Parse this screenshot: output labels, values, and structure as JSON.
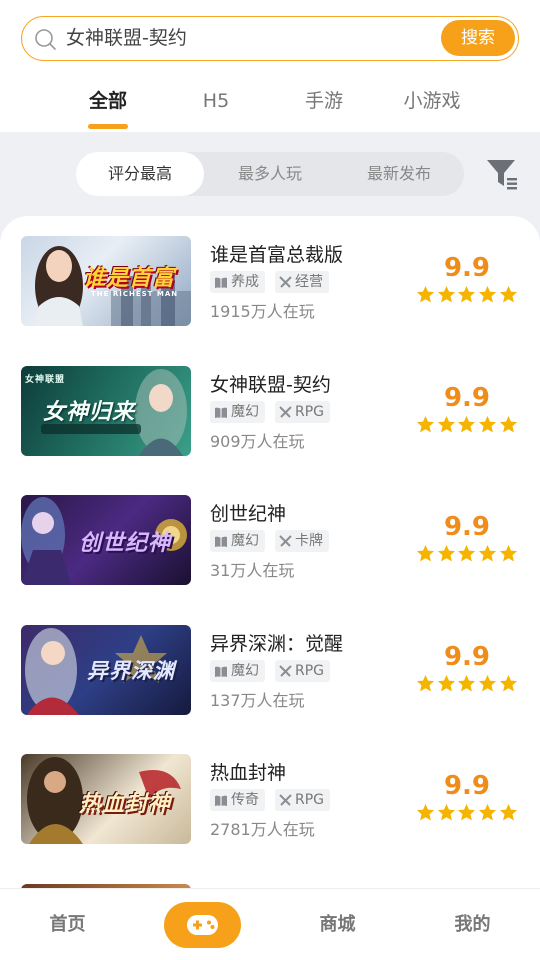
{
  "search": {
    "value": "女神联盟-契约",
    "button_label": "搜索"
  },
  "tabs": [
    {
      "label": "全部",
      "active": true
    },
    {
      "label": "H5",
      "active": false
    },
    {
      "label": "手游",
      "active": false
    },
    {
      "label": "小游戏",
      "active": false
    }
  ],
  "sort_options": [
    {
      "label": "评分最高",
      "active": true
    },
    {
      "label": "最多人玩",
      "active": false
    },
    {
      "label": "最新发布",
      "active": false
    }
  ],
  "games": [
    {
      "name": "谁是首富总裁版",
      "tags": [
        {
          "icon": "book-icon",
          "label": "养成"
        },
        {
          "icon": "swords-icon",
          "label": "经营"
        }
      ],
      "players": "1915万人在玩",
      "score": "9.9",
      "stars": 5,
      "thumb_text": "谁是首富",
      "thumb_sub": "THE RICHEST MAN"
    },
    {
      "name": "女神联盟-契约",
      "tags": [
        {
          "icon": "book-icon",
          "label": "魔幻"
        },
        {
          "icon": "swords-icon",
          "label": "RPG"
        }
      ],
      "players": "909万人在玩",
      "score": "9.9",
      "stars": 5,
      "thumb_text": "女神归来",
      "thumb_sub": ""
    },
    {
      "name": "创世纪神",
      "tags": [
        {
          "icon": "book-icon",
          "label": "魔幻"
        },
        {
          "icon": "swords-icon",
          "label": "卡牌"
        }
      ],
      "players": "31万人在玩",
      "score": "9.9",
      "stars": 5,
      "thumb_text": "创世纪神",
      "thumb_sub": ""
    },
    {
      "name": "异界深渊：觉醒",
      "tags": [
        {
          "icon": "book-icon",
          "label": "魔幻"
        },
        {
          "icon": "swords-icon",
          "label": "RPG"
        }
      ],
      "players": "137万人在玩",
      "score": "9.9",
      "stars": 5,
      "thumb_text": "异界深渊",
      "thumb_sub": ""
    },
    {
      "name": "热血封神",
      "tags": [
        {
          "icon": "book-icon",
          "label": "传奇"
        },
        {
          "icon": "swords-icon",
          "label": "RPG"
        }
      ],
      "players": "2781万人在玩",
      "score": "9.9",
      "stars": 5,
      "thumb_text": "热血封神",
      "thumb_sub": ""
    }
  ],
  "bottom_nav": [
    {
      "label": "首页",
      "active": false
    },
    {
      "label": "",
      "icon": "gamepad-icon",
      "active": true
    },
    {
      "label": "商城",
      "active": false
    },
    {
      "label": "我的",
      "active": false
    }
  ],
  "colors": {
    "accent": "#f7a11a",
    "score": "#f08c1a",
    "star": "#f5b400"
  }
}
